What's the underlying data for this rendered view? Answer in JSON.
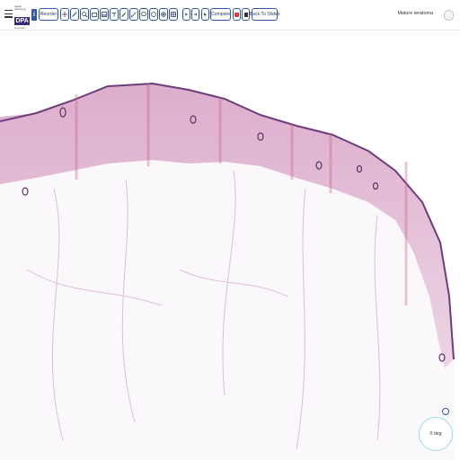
{
  "app": {
    "logo_text": "DPA",
    "logo_sup": "digital pathology",
    "logo_sub": "association"
  },
  "toolbar": {
    "info_label": "i",
    "reorder_label": "Reorder",
    "compare_label": "Compare",
    "back_label": "Back To Slides",
    "tools": [
      "pan-icon",
      "pencil-icon",
      "zoom-icon",
      "crop-icon",
      "image-icon",
      "measure-icon",
      "stamp-icon",
      "brush-icon",
      "line-icon",
      "circle-icon",
      "magic-icon",
      "spiral-icon",
      "grid-icon"
    ]
  },
  "header": {
    "diagnosis": "Mature teratoma"
  },
  "viewer": {
    "rotation_text": "0 deg"
  },
  "colors": {
    "accent": "#2f56a8",
    "logo_bg": "#3a2a78",
    "stain_pink": "#d9a3c6",
    "stain_purple": "#6d3c7c",
    "rotation_ring": "#9fd9e7",
    "record_red": "#e23b4a"
  }
}
